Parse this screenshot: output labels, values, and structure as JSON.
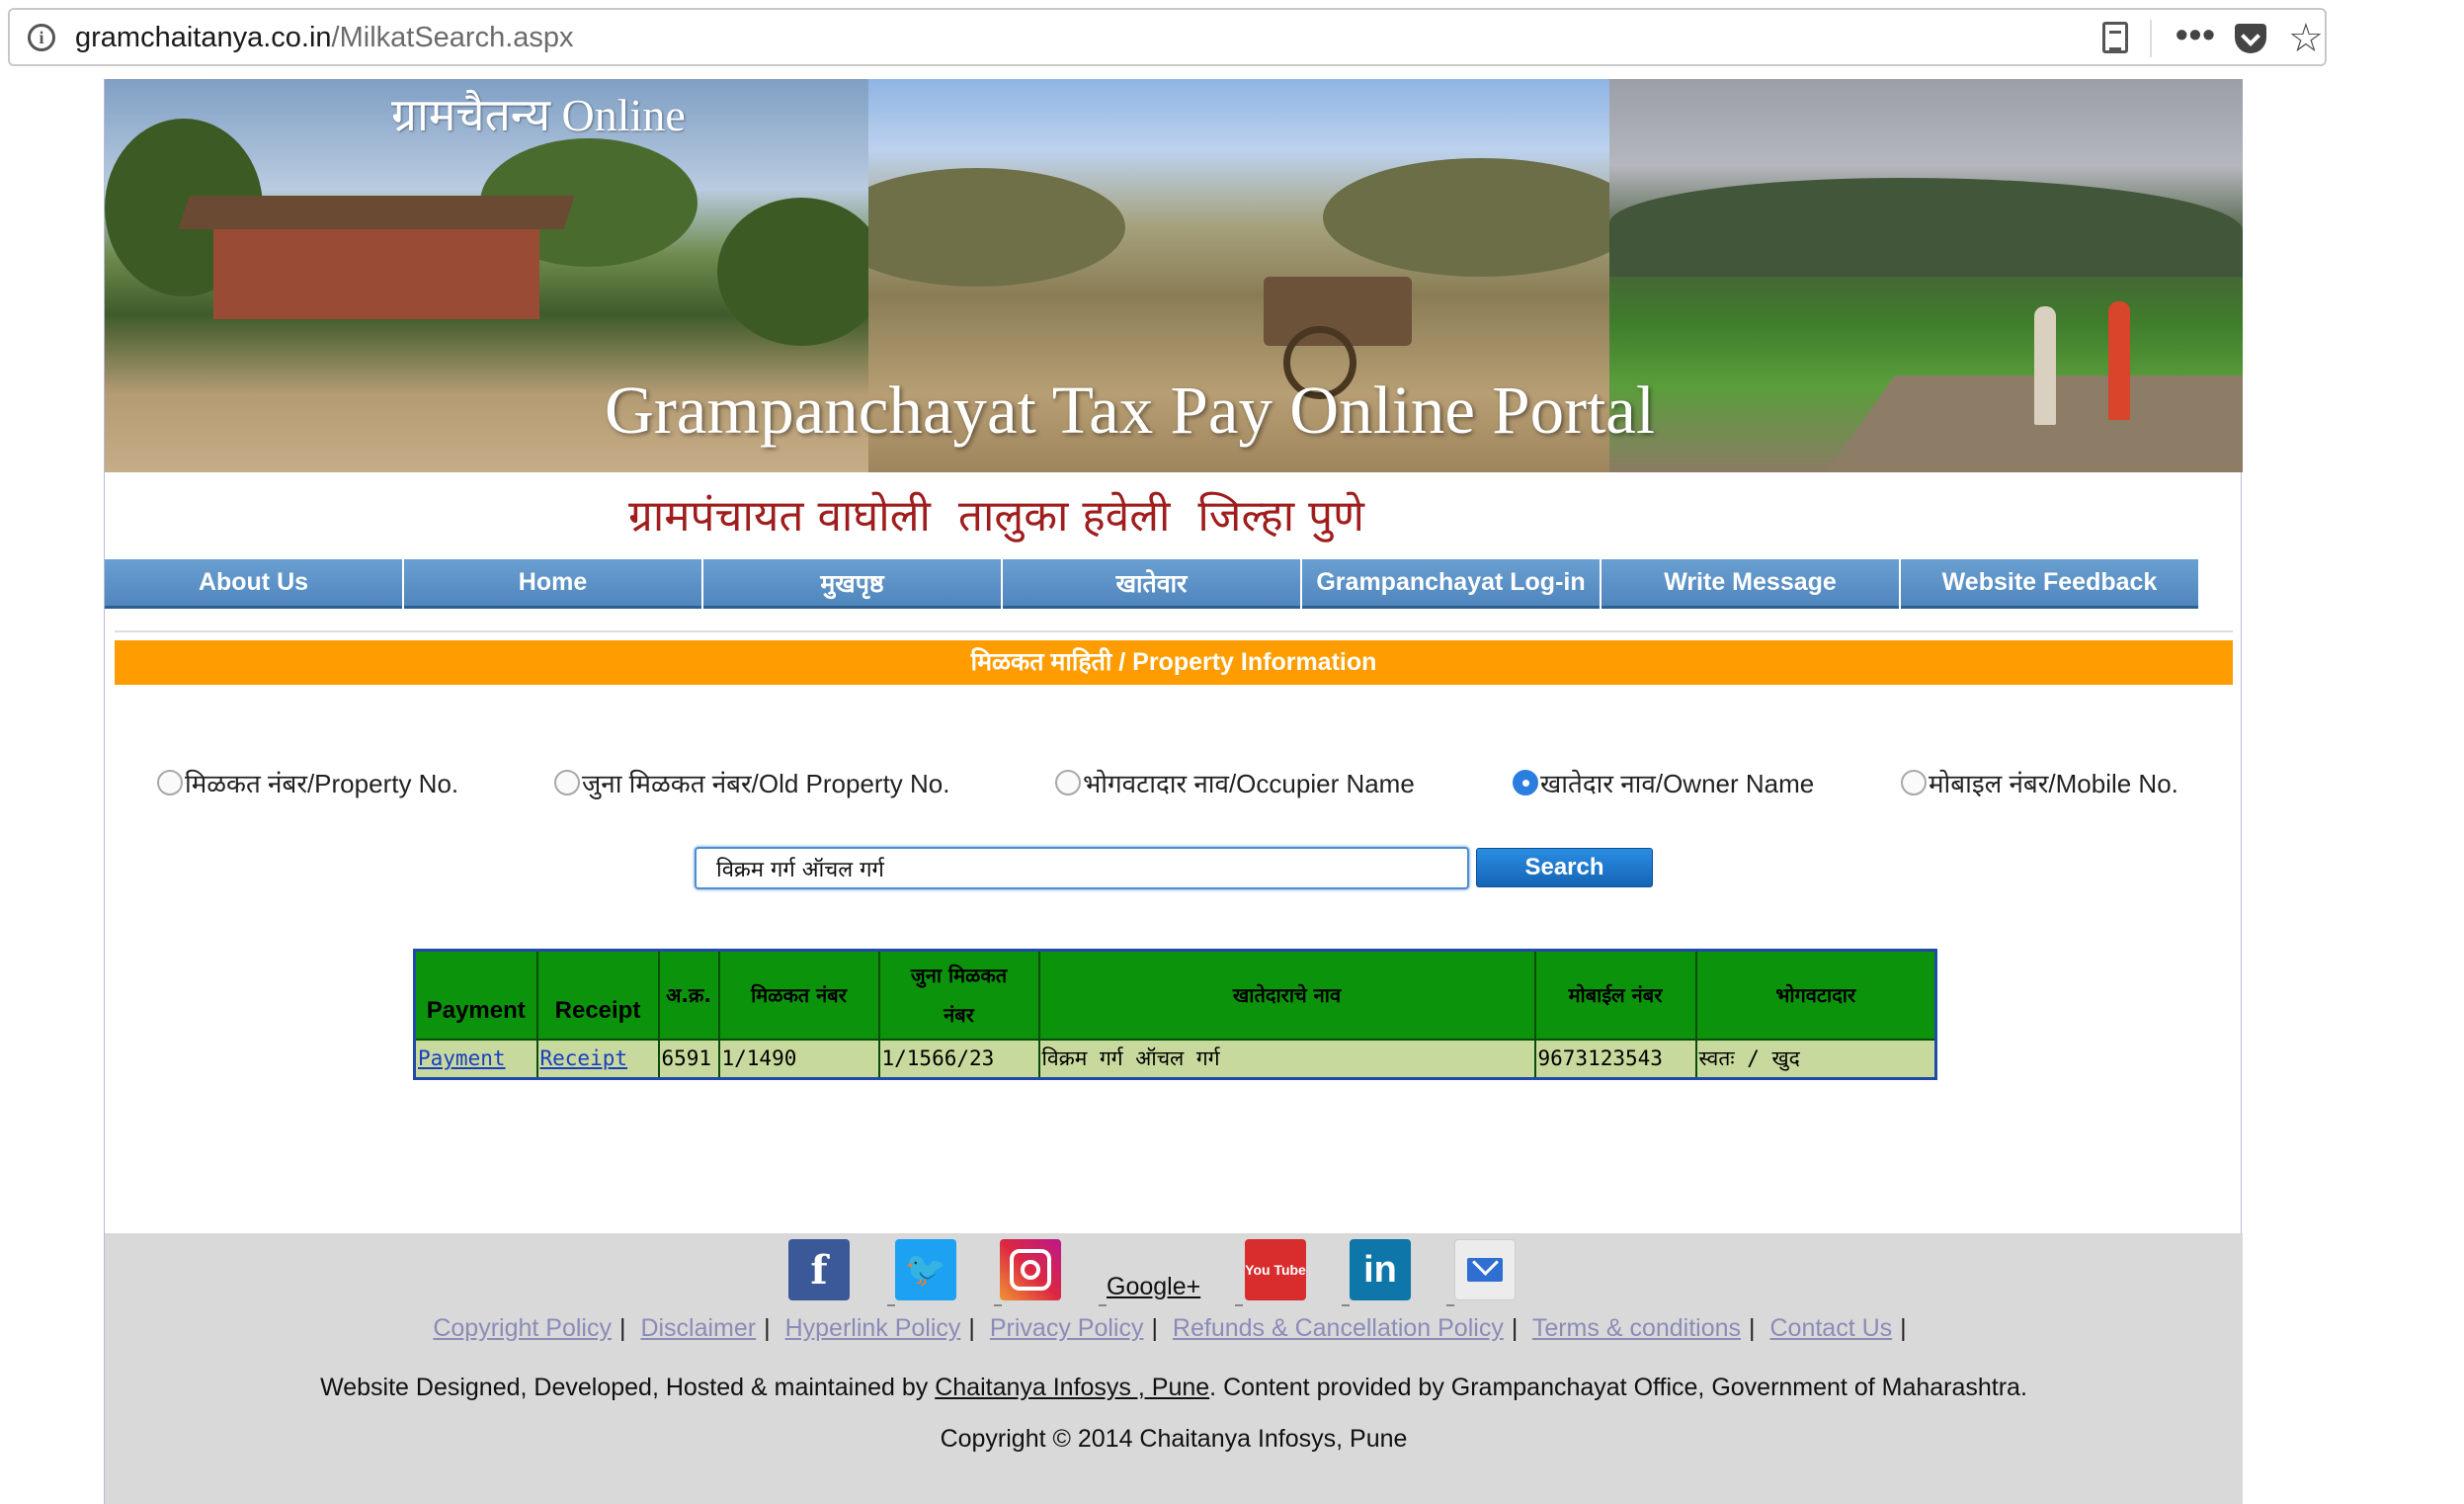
{
  "browser": {
    "url_host": "gramchaitanya.co.in",
    "url_path": "/MilkatSearch.aspx",
    "icons": [
      "info-icon",
      "reader-view-icon",
      "more-icon",
      "pocket-icon",
      "bookmark-star-icon"
    ]
  },
  "banner": {
    "brand": "ग्रामचैतन्य Online",
    "title": "Grampanchayat Tax Pay Online Portal"
  },
  "gp_heading": "ग्रामपंचायत वाघोली  तालुका हवेली  जिल्हा पुणे",
  "nav": {
    "items": [
      "About Us",
      "Home",
      "मुखपृष्ठ",
      "खातेवार",
      "Grampanchayat Log-in",
      "Write Message",
      "Website Feedback"
    ],
    "color": "#4f86bd"
  },
  "section_title": "मिळकत माहिती / Property Information",
  "section_color": "#ff9d00",
  "search_options": [
    {
      "label": "मिळकत नंबर/Property No.",
      "selected": false
    },
    {
      "label": "जुना मिळकत नंबर/Old Property No.",
      "selected": false
    },
    {
      "label": "भोगवटादार नाव/Occupier Name",
      "selected": false
    },
    {
      "label": "खातेदार नाव/Owner Name",
      "selected": true
    },
    {
      "label": "मोबाइल नंबर/Mobile No.",
      "selected": false
    }
  ],
  "search": {
    "value": "विक्रम गर्ग ऑचल गर्ग",
    "button": "Search"
  },
  "results": {
    "headers": {
      "payment": "Payment",
      "receipt": "Receipt",
      "sr_no": "अ.क्र.",
      "property_no": "मिळकत नंबर",
      "old_property_no": "जुना मिळकत नंबर",
      "owner_name": "खातेदाराचे नाव",
      "mobile": "मोबाईल नंबर",
      "occupier": "भोगवटादार"
    },
    "rows": [
      {
        "payment": "Payment",
        "receipt": "Receipt",
        "sr_no": "6591",
        "property_no": "1/1490",
        "old_property_no": "1/1566/23",
        "owner_name": "विक्रम गर्ग ऑचल गर्ग",
        "mobile": "9673123543",
        "occupier": "स्वतः / खुद"
      }
    ],
    "header_color": "#0c930c",
    "row_color": "#c7d99c"
  },
  "footer": {
    "social_icons": [
      "facebook-icon",
      "twitter-icon",
      "instagram-icon",
      "youtube-icon",
      "linkedin-icon",
      "email-icon"
    ],
    "social_text": {
      "facebook": "f",
      "youtube": "You Tube",
      "linkedin": "in"
    },
    "google_plus": "Google+",
    "links": [
      "Copyright Policy",
      "Disclaimer",
      "Hyperlink Policy",
      "Privacy Policy",
      "Refunds & Cancellation Policy",
      "Terms & conditions",
      "Contact Us"
    ],
    "link_sep": "|",
    "credit_pre": "Website Designed, Developed, Hosted & maintained by ",
    "credit_link": "Chaitanya Infosys , Pune",
    "credit_post": ". Content provided by Grampanchayat Office, Government of Maharashtra.",
    "copyright": "Copyright © 2014 Chaitanya Infosys, Pune"
  }
}
